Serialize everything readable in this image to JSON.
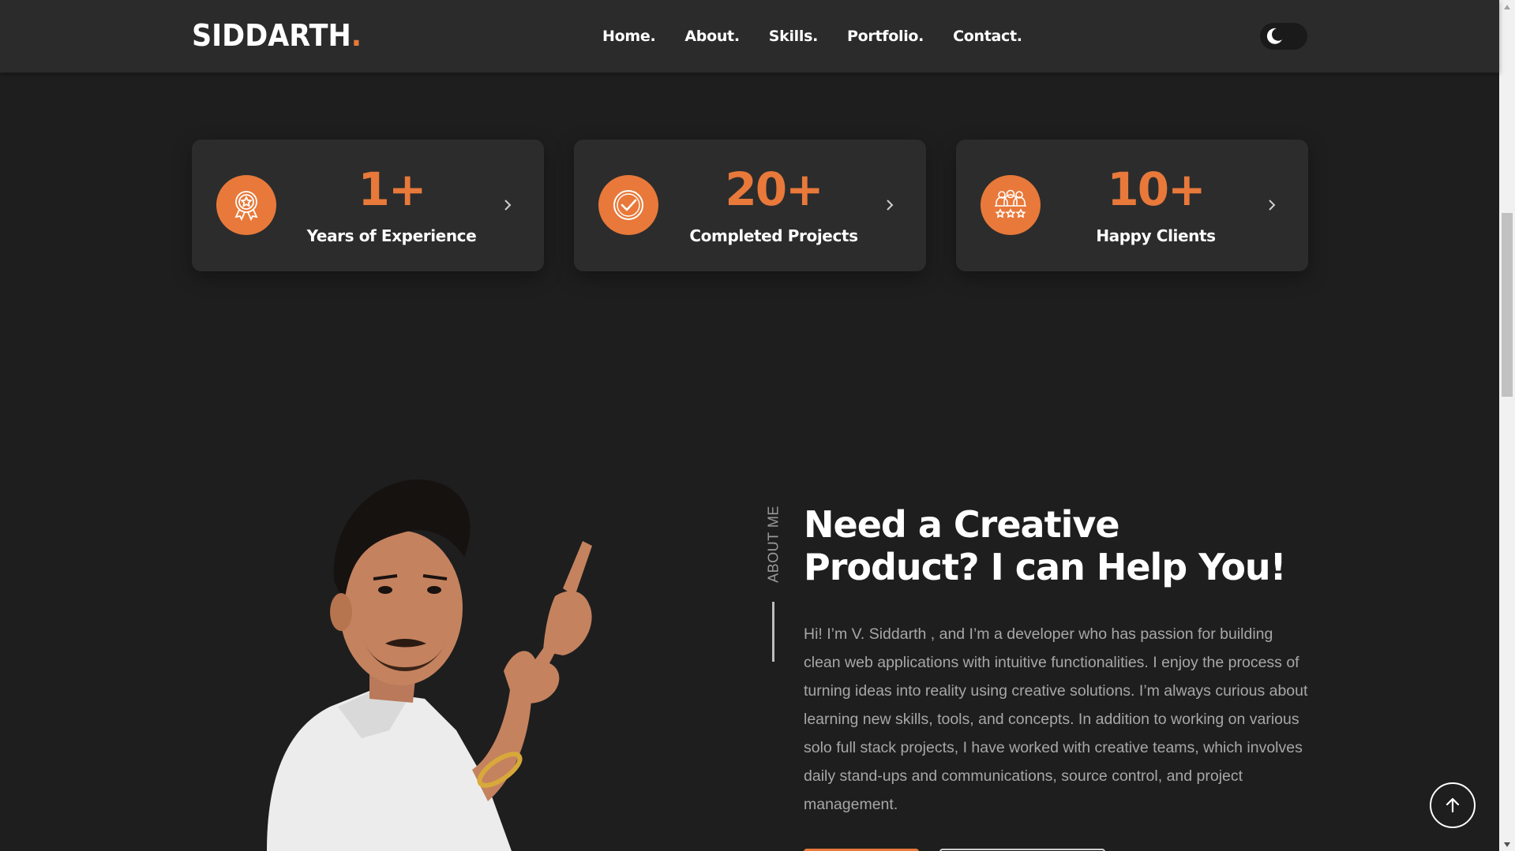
{
  "header": {
    "logo_text": "SIDDARTH",
    "logo_dot": ".",
    "nav": [
      {
        "label": "Home."
      },
      {
        "label": "About."
      },
      {
        "label": "Skills."
      },
      {
        "label": "Portfolio."
      },
      {
        "label": "Contact."
      }
    ],
    "theme_toggle_icon": "moon-icon"
  },
  "stats": [
    {
      "value": "1+",
      "label": "Years of Experience",
      "icon": "award-badge-icon"
    },
    {
      "value": "20+",
      "label": "Completed Projects",
      "icon": "check-circle-icon"
    },
    {
      "value": "10+",
      "label": "Happy Clients",
      "icon": "clients-stars-icon"
    }
  ],
  "about": {
    "side_label": "ABOUT ME",
    "title_line1": "Need a Creative",
    "title_line2": "Product? I can Help You!",
    "paragraph": "Hi! I’m V. Siddarth , and I’m a developer who has passion for building clean web applications with intuitive functionalities. I enjoy the process of turning ideas into reality using creative solutions. I’m always curious about learning new skills, tools, and concepts. In addition to working on various solo full stack projects, I have worked with creative teams, which involves daily stand-ups and communications, source control, and project management."
  },
  "colors": {
    "accent": "#e8793a",
    "background": "#1e1e1e",
    "header_bg": "#2b2b2b",
    "card_bg": "#2c2c2c"
  },
  "scroll_to_top_icon": "arrow-up-icon"
}
